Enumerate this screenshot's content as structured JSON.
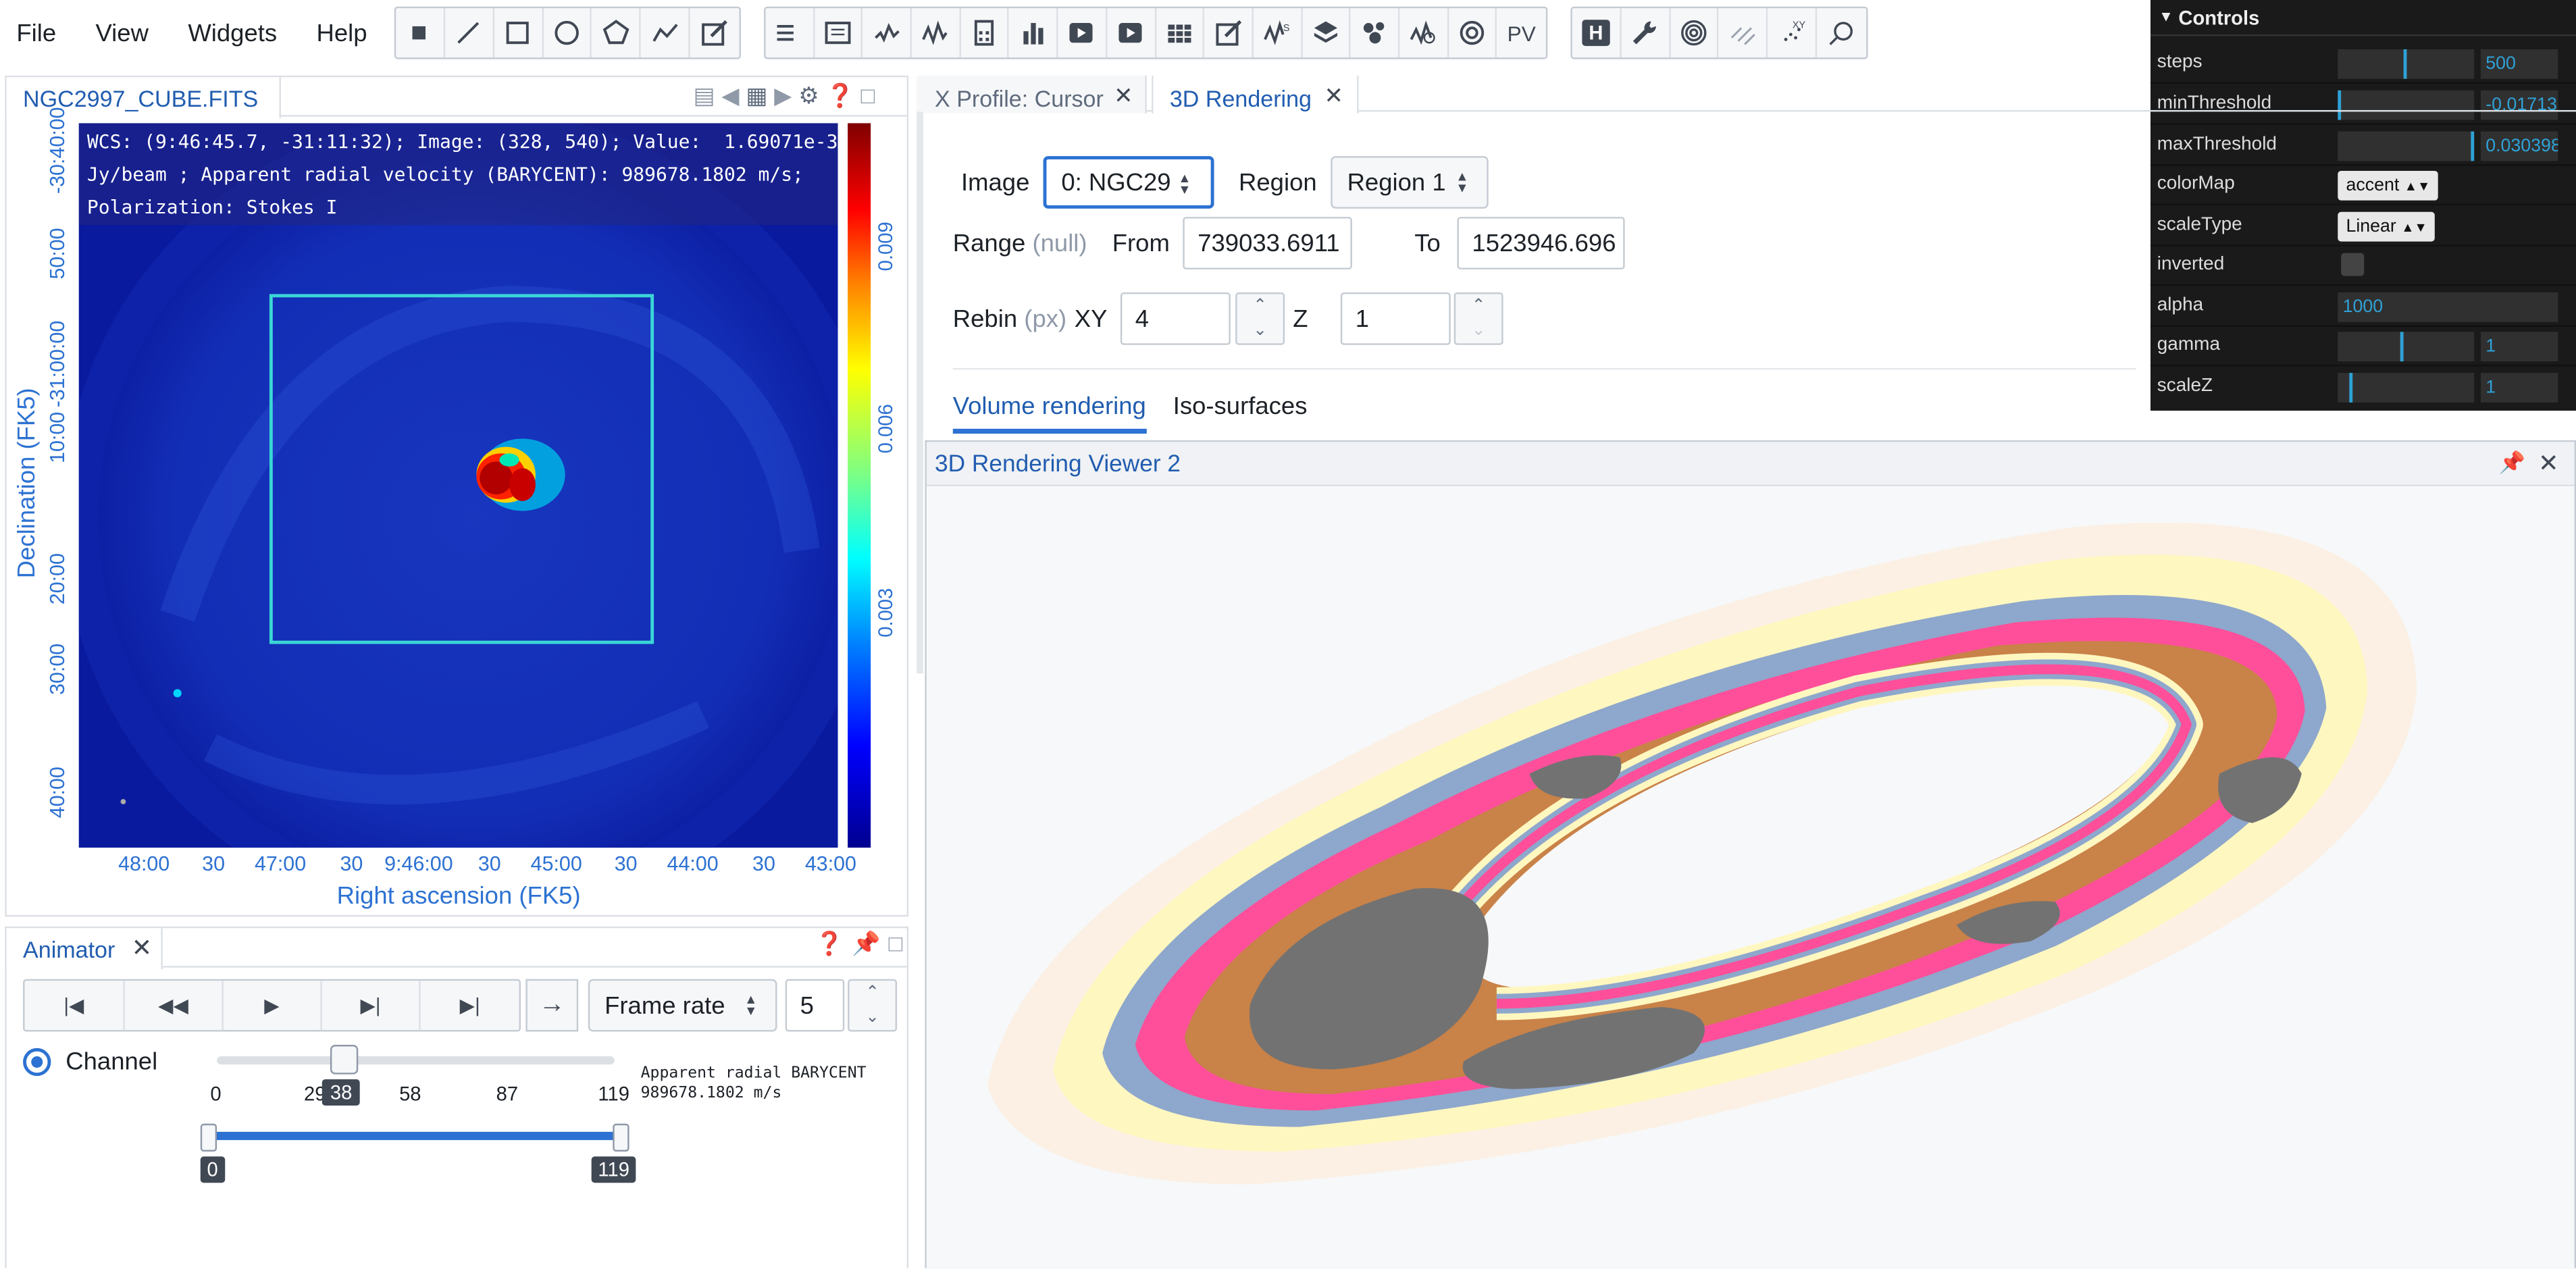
{
  "menu": {
    "file": "File",
    "view": "View",
    "widgets": "Widgets",
    "help": "Help"
  },
  "toolbar_icons": [
    "point-icon",
    "line-icon",
    "rectangle-icon",
    "ellipse-icon",
    "polygon-icon",
    "polyline-icon",
    "annotation-icon",
    "region-list-icon",
    "file-header-icon",
    "spatial-profiler-icon",
    "spectral-profiler-icon",
    "statistics-icon",
    "histogram-icon",
    "animator-icon",
    "render-config-icon",
    "image-list-icon",
    "catalog-icon",
    "stokes-icon",
    "layer-icon",
    "cursor-info-icon",
    "spectral-line-icon",
    "online-catalog-icon",
    "pv-icon",
    "hdu-icon",
    "wrench-icon",
    "fitting-icon",
    "channel-map-icon",
    "moment-icon",
    "vector-field-icon"
  ],
  "toolbar_text": {
    "pv": "PV",
    "h": "H"
  },
  "image_panel": {
    "tab": "NGC2997_CUBE.FITS",
    "wcs_line1": "WCS: (9:46:45.7, -31:11:32); Image: (328, 540); Value:  1.69071e-3",
    "wcs_line2": "Jy/beam ; Apparent radial velocity (BARYCENT): 989678.1802 m/s;",
    "wcs_line3": "Polarization: Stokes I",
    "ylabel": "Declination (FK5)",
    "xlabel": "Right ascension (FK5)",
    "yticks": [
      "-30:40:00",
      "50:00",
      "-31:00:00",
      "10:00",
      "20:00",
      "30:00",
      "40:00"
    ],
    "xticks": [
      "48:00",
      "30",
      "47:00",
      "30",
      "9:46:00",
      "30",
      "45:00",
      "30",
      "44:00",
      "30",
      "43:00"
    ],
    "colorbar_ticks": [
      "0.009",
      "0.006",
      "0.003"
    ]
  },
  "animator": {
    "tab": "Animator",
    "frame_rate_label": "Frame rate",
    "frame_rate_value": "5",
    "channel_label": "Channel",
    "channel_current": "38",
    "channel_current_fraction": 0.319,
    "ticks": [
      "0",
      "29",
      "58",
      "87",
      "119"
    ],
    "velocity_line1": "Apparent radial BARYCENT",
    "velocity_line2": "989678.1802 m/s",
    "range_min": "0",
    "range_max": "119"
  },
  "profile_tabs": {
    "x_profile": "X Profile: Cursor",
    "render3d": "3D Rendering"
  },
  "render_form": {
    "image_label": "Image",
    "image_value": "0: NGC29",
    "region_label": "Region",
    "region_value": "Region 1",
    "range_label": "Range",
    "range_unit": "(null)",
    "from_label": "From",
    "from_value": "739033.6911",
    "to_label": "To",
    "to_value": "1523946.696",
    "rebin_label": "Rebin",
    "rebin_unit": "(px)",
    "xy_label": "XY",
    "xy_value": "4",
    "z_label": "Z",
    "z_value": "1",
    "tab_volume": "Volume rendering",
    "tab_iso": "Iso-surfaces"
  },
  "viewer": {
    "title": "3D Rendering Viewer 2"
  },
  "controls": {
    "header": "Controls",
    "steps_label": "steps",
    "steps_value": "500",
    "steps_fraction": 0.5,
    "min_label": "minThreshold",
    "min_value": "-0.01713",
    "min_fraction": 0.0,
    "max_label": "maxThreshold",
    "max_value": "0.030398",
    "max_fraction": 1.0,
    "colormap_label": "colorMap",
    "colormap_value": "accent",
    "scaletype_label": "scaleType",
    "scaletype_value": "Linear",
    "inverted_label": "inverted",
    "alpha_label": "alpha",
    "alpha_value": "1000",
    "gamma_label": "gamma",
    "gamma_value": "1",
    "gamma_fraction": 0.47,
    "scalez_label": "scaleZ",
    "scalez_value": "1",
    "scalez_fraction": 0.09
  },
  "colors": {
    "accent": "#215db0",
    "image_bg": "#0a1a9e",
    "region": "#3ad6d6",
    "controls_bg": "#1a1a1a",
    "slider_blue": "#2fa1d6"
  }
}
